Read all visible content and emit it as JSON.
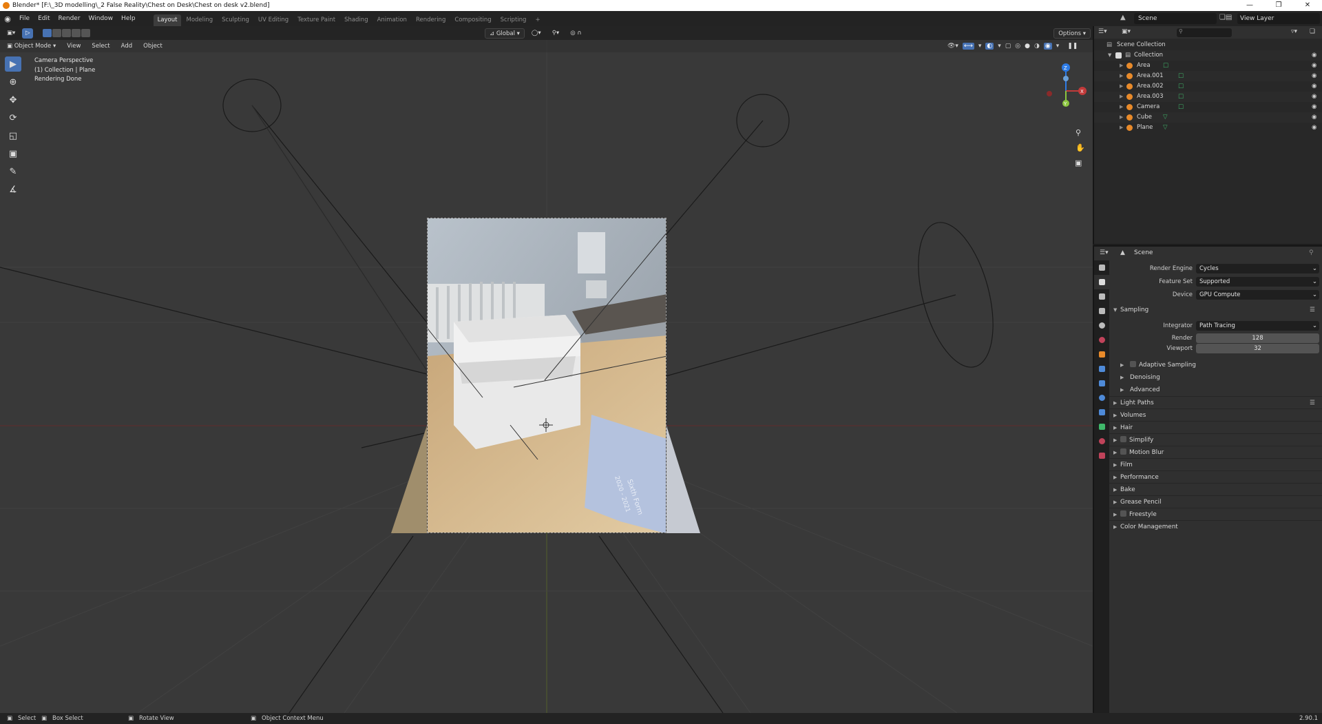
{
  "window": {
    "title": "Blender* [F:\\_3D modelling\\_2 False Reality\\Chest on Desk\\Chest on desk v2.blend]",
    "controls": [
      "—",
      "❐",
      "✕"
    ]
  },
  "menu": [
    "File",
    "Edit",
    "Render",
    "Window",
    "Help"
  ],
  "workspaces": [
    "Layout",
    "Modeling",
    "Sculpting",
    "UV Editing",
    "Texture Paint",
    "Shading",
    "Animation",
    "Rendering",
    "Compositing",
    "Scripting",
    "+"
  ],
  "active_workspace": "Layout",
  "scene": {
    "name": "Scene"
  },
  "view_layer": {
    "name": "View Layer"
  },
  "viewport": {
    "mode": "Object Mode",
    "menus": [
      "View",
      "Select",
      "Add",
      "Object"
    ],
    "transform_orientation": "Global",
    "options_label": "Options",
    "info": [
      "Camera Perspective",
      "(1) Collection | Plane",
      "Rendering Done"
    ],
    "gizmo_axes": {
      "x": "X",
      "y": "Y",
      "z": "Z"
    }
  },
  "outliner": {
    "root": "Scene Collection",
    "collection": "Collection",
    "items": [
      {
        "name": "Area",
        "type": "light"
      },
      {
        "name": "Area.001",
        "type": "light"
      },
      {
        "name": "Area.002",
        "type": "light"
      },
      {
        "name": "Area.003",
        "type": "light"
      },
      {
        "name": "Camera",
        "type": "camera"
      },
      {
        "name": "Cube",
        "type": "mesh"
      },
      {
        "name": "Plane",
        "type": "mesh"
      }
    ]
  },
  "properties": {
    "context": "Scene",
    "render_engine": {
      "label": "Render Engine",
      "value": "Cycles"
    },
    "feature_set": {
      "label": "Feature Set",
      "value": "Supported"
    },
    "device": {
      "label": "Device",
      "value": "GPU Compute"
    },
    "sampling": {
      "title": "Sampling",
      "integrator": {
        "label": "Integrator",
        "value": "Path Tracing"
      },
      "render": {
        "label": "Render",
        "value": "128"
      },
      "viewport": {
        "label": "Viewport",
        "value": "32"
      },
      "subpanels": [
        "Adaptive Sampling",
        "Denoising",
        "Advanced"
      ]
    },
    "panels": [
      {
        "label": "Light Paths",
        "checkbox": false
      },
      {
        "label": "Volumes",
        "checkbox": false
      },
      {
        "label": "Hair",
        "checkbox": false
      },
      {
        "label": "Simplify",
        "checkbox": true
      },
      {
        "label": "Motion Blur",
        "checkbox": true
      },
      {
        "label": "Film",
        "checkbox": false
      },
      {
        "label": "Performance",
        "checkbox": false
      },
      {
        "label": "Bake",
        "checkbox": false
      },
      {
        "label": "Grease Pencil",
        "checkbox": false
      },
      {
        "label": "Freestyle",
        "checkbox": true
      },
      {
        "label": "Color Management",
        "checkbox": false
      }
    ]
  },
  "render_overlay": {
    "book_text": [
      "Sixth Form",
      "2020 - 2021"
    ]
  },
  "statusbar": {
    "select": "Select",
    "box_select": "Box Select",
    "rotate_view": "Rotate View",
    "context_menu": "Object Context Menu",
    "version": "2.90.1"
  },
  "colors": {
    "accent": "#4772b3",
    "logo": "#e87d0d",
    "x_axis": "#c23a3a",
    "y_axis": "#8cc63f",
    "z_axis": "#2d7be6"
  }
}
